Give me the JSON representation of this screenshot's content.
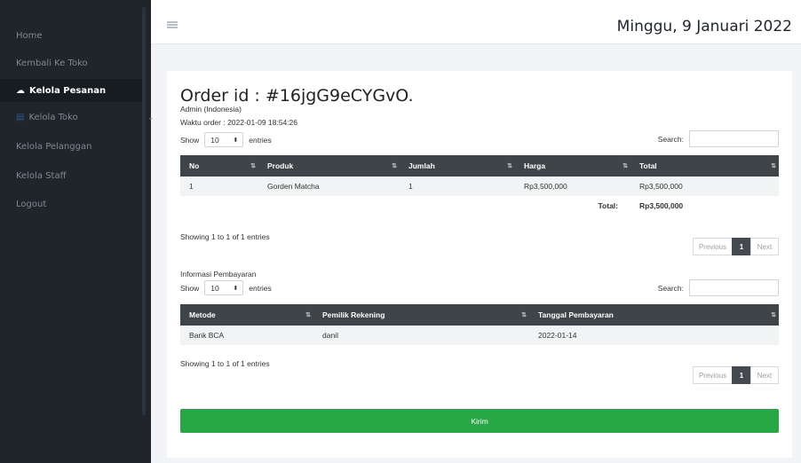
{
  "sidebar": {
    "items": [
      {
        "label": "Home"
      },
      {
        "label": "Kembali Ke Toko"
      },
      {
        "label": "Kelola Pesanan",
        "icon": "cloud-icon"
      },
      {
        "label": "Kelola Toko",
        "icon": "table-icon"
      },
      {
        "label": "Kelola Pelanggan"
      },
      {
        "label": "Kelola Staff"
      },
      {
        "label": "Logout"
      }
    ]
  },
  "header": {
    "date": "Minggu, 9 Januari 2022"
  },
  "order": {
    "title": "Order id : #16jgG9eCYGvO.",
    "admin": "Admin (Indonesia)",
    "waktu": "Waktu order : 2022-01-09 18:54:26"
  },
  "table1": {
    "show_label": "Show",
    "entries_value": "10",
    "entries_label": "entries",
    "search_label": "Search:",
    "columns": [
      "No",
      "Produk",
      "Jumlah",
      "Harga",
      "Total"
    ],
    "rows": [
      [
        "1",
        "Gorden Matcha",
        "1",
        "Rp3,500,000",
        "Rp3,500,000"
      ]
    ],
    "total_label": "Total:",
    "total_value": "Rp3,500,000",
    "showing": "Showing 1 to 1 of 1 entries",
    "prev": "Previous",
    "page": "1",
    "next": "Next"
  },
  "payment": {
    "section_label": "Informasi Pembayaran",
    "show_label": "Show",
    "entries_value": "10",
    "entries_label": "entries",
    "search_label": "Search:",
    "columns": [
      "Metode",
      "Pemilik Rekening",
      "Tanggal Pembayaran"
    ],
    "rows": [
      [
        "Bank BCA",
        "danil",
        "2022-01-14"
      ]
    ],
    "showing": "Showing 1 to 1 of 1 entries",
    "prev": "Previous",
    "page": "1",
    "next": "Next"
  },
  "submit_label": "Kirim"
}
